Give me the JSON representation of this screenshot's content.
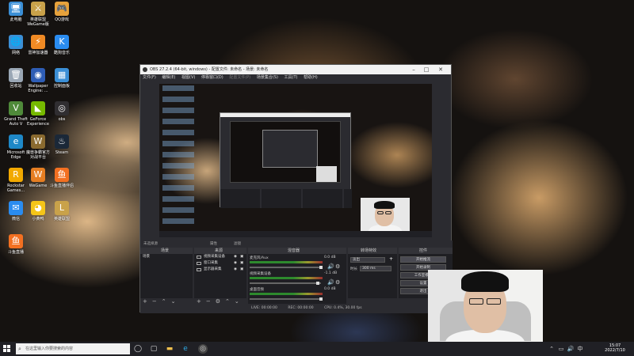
{
  "desktop": {
    "icons": [
      {
        "label": "此电脑",
        "name": "this-pc-icon",
        "glyph": "🖥",
        "color": "#3b8fd6"
      },
      {
        "label": "英雄联盟\nWeGame版",
        "name": "league-wegame-icon",
        "glyph": "⚔",
        "color": "#c9a24a"
      },
      {
        "label": "QQ游戏",
        "name": "qq-game-icon",
        "glyph": "🎮",
        "color": "#e6a23c"
      },
      {
        "label": "网络",
        "name": "network-icon",
        "glyph": "🌐",
        "color": "#3b8fd6"
      },
      {
        "label": "雷神加速器",
        "name": "leishen-accelerator-icon",
        "glyph": "⚡",
        "color": "#f08a24"
      },
      {
        "label": "酷狗音乐",
        "name": "kugou-music-icon",
        "glyph": "K",
        "color": "#2a8cf0"
      },
      {
        "label": "回收站",
        "name": "recycle-bin-icon",
        "glyph": "🗑",
        "color": "#9aa7b5"
      },
      {
        "label": "Wallpaper\nEngine: ...",
        "name": "wallpaper-engine-icon",
        "glyph": "◉",
        "color": "#2e5db5"
      },
      {
        "label": "控制面板",
        "name": "control-panel-icon",
        "glyph": "▦",
        "color": "#3b8fd6"
      },
      {
        "label": "Grand Theft\nAuto V",
        "name": "gta-v-icon",
        "glyph": "V",
        "color": "#4f8a3a"
      },
      {
        "label": "GeForce\nExperience",
        "name": "geforce-experience-icon",
        "glyph": "◣",
        "color": "#76b900"
      },
      {
        "label": "obs",
        "name": "obs-icon",
        "glyph": "◎",
        "color": "#302e31"
      },
      {
        "label": "Microsoft\nEdge",
        "name": "edge-icon",
        "glyph": "e",
        "color": "#1e88c7"
      },
      {
        "label": "魔兽争霸官方\n对战平台",
        "name": "warcraft-platform-icon",
        "glyph": "W",
        "color": "#8a6a2f"
      },
      {
        "label": "Steam",
        "name": "steam-icon",
        "glyph": "♨",
        "color": "#1b2838"
      },
      {
        "label": "Rockstar\nGames...",
        "name": "rockstar-icon",
        "glyph": "R",
        "color": "#f2a900"
      },
      {
        "label": "WeGame",
        "name": "wegame-icon",
        "glyph": "W",
        "color": "#e67e22"
      },
      {
        "label": "斗鱼直播伴侣",
        "name": "douyu-companion-icon",
        "glyph": "鱼",
        "color": "#f37021"
      },
      {
        "label": "微信",
        "name": "wechat-icon",
        "glyph": "✉",
        "color": "#2a8cf0"
      },
      {
        "label": "小黄鸭",
        "name": "duck-icon",
        "glyph": "◕",
        "color": "#f5c518"
      },
      {
        "label": "英雄联盟",
        "name": "league-icon",
        "glyph": "L",
        "color": "#c9a24a"
      },
      {
        "label": "斗鱼直播",
        "name": "douyu-live-icon",
        "glyph": "鱼",
        "color": "#f37021"
      }
    ]
  },
  "obs": {
    "title": "OBS 27.2.4 (64-bit, windows) - 配置文件: 未命名 - 场景: 未命名",
    "menu": [
      "文件(F)",
      "编辑(E)",
      "视图(V)",
      "停靠窗口(D)",
      "配置文件(P)",
      "场景集合(S)",
      "工具(T)",
      "帮助(H)"
    ],
    "scene_bar_label": "未选择源",
    "props_button": "属性",
    "filters_button": "滤镜",
    "docks": {
      "scenes": {
        "title": "场景",
        "items": [
          "场景"
        ]
      },
      "sources": {
        "title": "来源",
        "items": [
          "视频采集设备",
          "窗口采集",
          "显示器采集"
        ]
      },
      "mixer": {
        "title": "混音器"
      },
      "transitions": {
        "title": "转场特效",
        "type": "淡出",
        "duration_label": "时长",
        "duration_value": "300 ms"
      },
      "controls": {
        "title": "控件",
        "buttons": [
          "开始推流",
          "开始录制",
          "工作室模式",
          "设置",
          "退出"
        ]
      }
    },
    "mixer_rows": [
      {
        "name": "麦克风/Aux",
        "db": "0.0 dB"
      },
      {
        "name": "视频采集设备",
        "db": "-1.1 dB"
      },
      {
        "name": "桌面音频",
        "db": "0.0 dB"
      }
    ],
    "status": {
      "live": "LIVE: 00:00:00",
      "rec": "REC: 00:00:00",
      "cpu": "CPU: 0.4%, 30.00 fps"
    }
  },
  "taskbar": {
    "search_placeholder": "在这里输入你要搜索的内容",
    "time": "15:07",
    "date": "2022/7/10"
  }
}
